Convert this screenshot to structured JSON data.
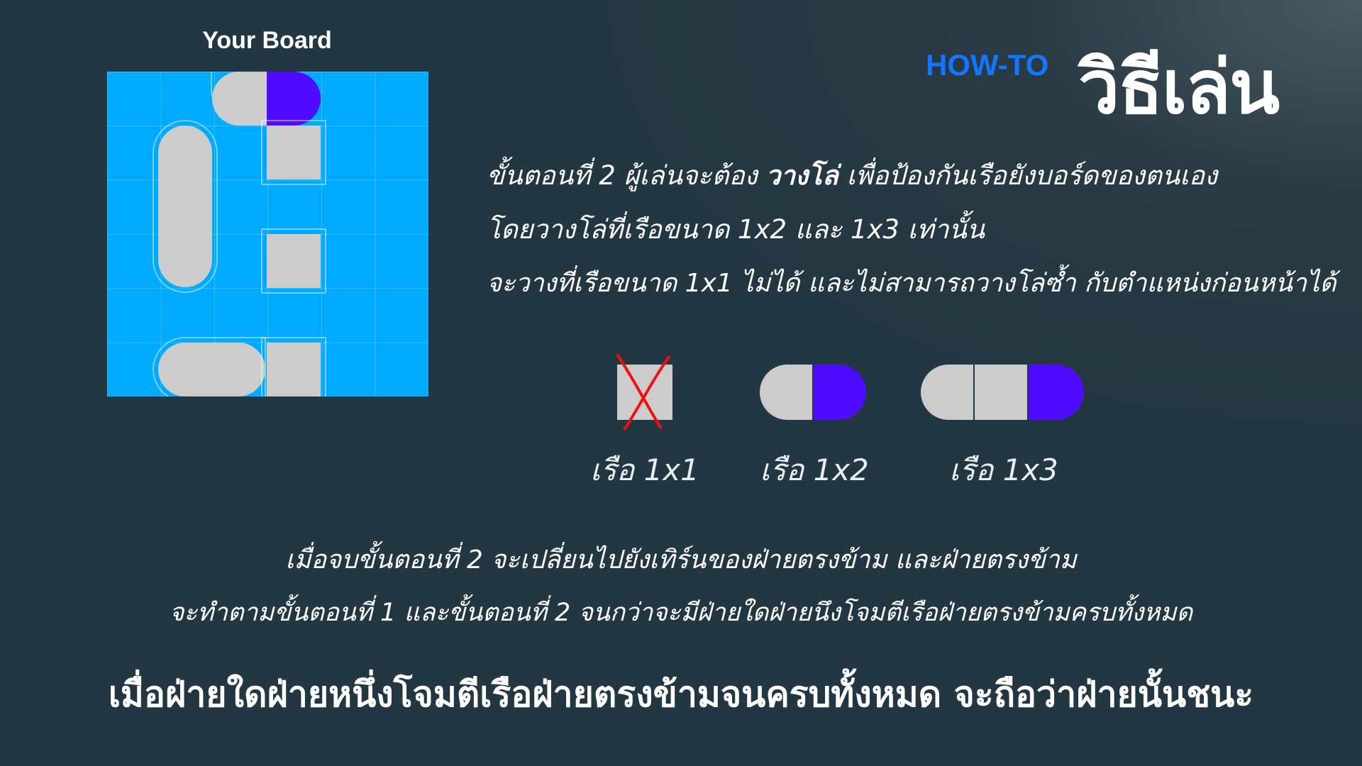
{
  "board": {
    "title": "Your Board",
    "colors": {
      "water": "#00aaff",
      "ship": "#cccccc",
      "hit": "#4f0bff"
    }
  },
  "header": {
    "howto": "HOW-TO",
    "title": "วิธีเล่น"
  },
  "instructions": {
    "line1_pre": "ขั้นตอนที่ 2 ผู้เล่นจะต้อง ",
    "line1_bold": "วางโล่",
    "line1_post": " เพื่อป้องกันเรือยังบอร์ดของตนเอง",
    "line2": "โดยวางโล่ที่เรือขนาด 1x2 และ 1x3 เท่านั้น",
    "line3": "จะวางที่เรือขนาด 1x1 ไม่ได้ และไม่สามารถวางโล่ซ้ำ กับตำแหน่งก่อนหน้าได้"
  },
  "ships": [
    {
      "label": "เรือ 1x1",
      "allowed": false
    },
    {
      "label": "เรือ 1x2",
      "allowed": true
    },
    {
      "label": "เรือ 1x3",
      "allowed": true
    }
  ],
  "paragraph": {
    "line1": "เมื่อจบขั้นตอนที่ 2 จะเปลี่ยนไปยังเทิร์นของฝ่ายตรงข้าม และฝ่ายตรงข้าม",
    "line2": "จะทำตามขั้นตอนที่ 1 และขั้นตอนที่ 2 จนกว่าจะมีฝ่ายใดฝ่ายนึงโจมตีเรือฝ่ายตรงข้ามครบทั้งหมด"
  },
  "final": "เมื่อฝ่ายใดฝ่ายหนึ่งโจมตีเรือฝ่ายตรงข้ามจนครบทั้งหมด จะถือว่าฝ่ายนั้นชนะ"
}
